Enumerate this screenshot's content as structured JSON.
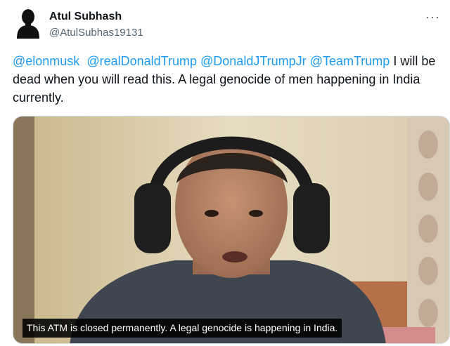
{
  "author": {
    "name": "Atul Subhash",
    "handle": "@AtulSubhas19131"
  },
  "menu": {
    "more_glyph": "···"
  },
  "tweet": {
    "mentions": [
      "@elonmusk",
      "@realDonaldTrump",
      "@DonaldJTrumpJr",
      "@TeamTrump"
    ],
    "text": "I will be dead when you will read this. A legal genocide of men happening in India currently."
  },
  "media": {
    "caption": "This ATM is closed permanently. A legal genocide is happening in India."
  },
  "colors": {
    "link": "#1d9bf0",
    "text": "#0f1419",
    "secondary": "#536471",
    "border": "#cfd9de"
  },
  "icons": {
    "avatar": "silhouette-icon",
    "more": "more-dots-icon"
  }
}
